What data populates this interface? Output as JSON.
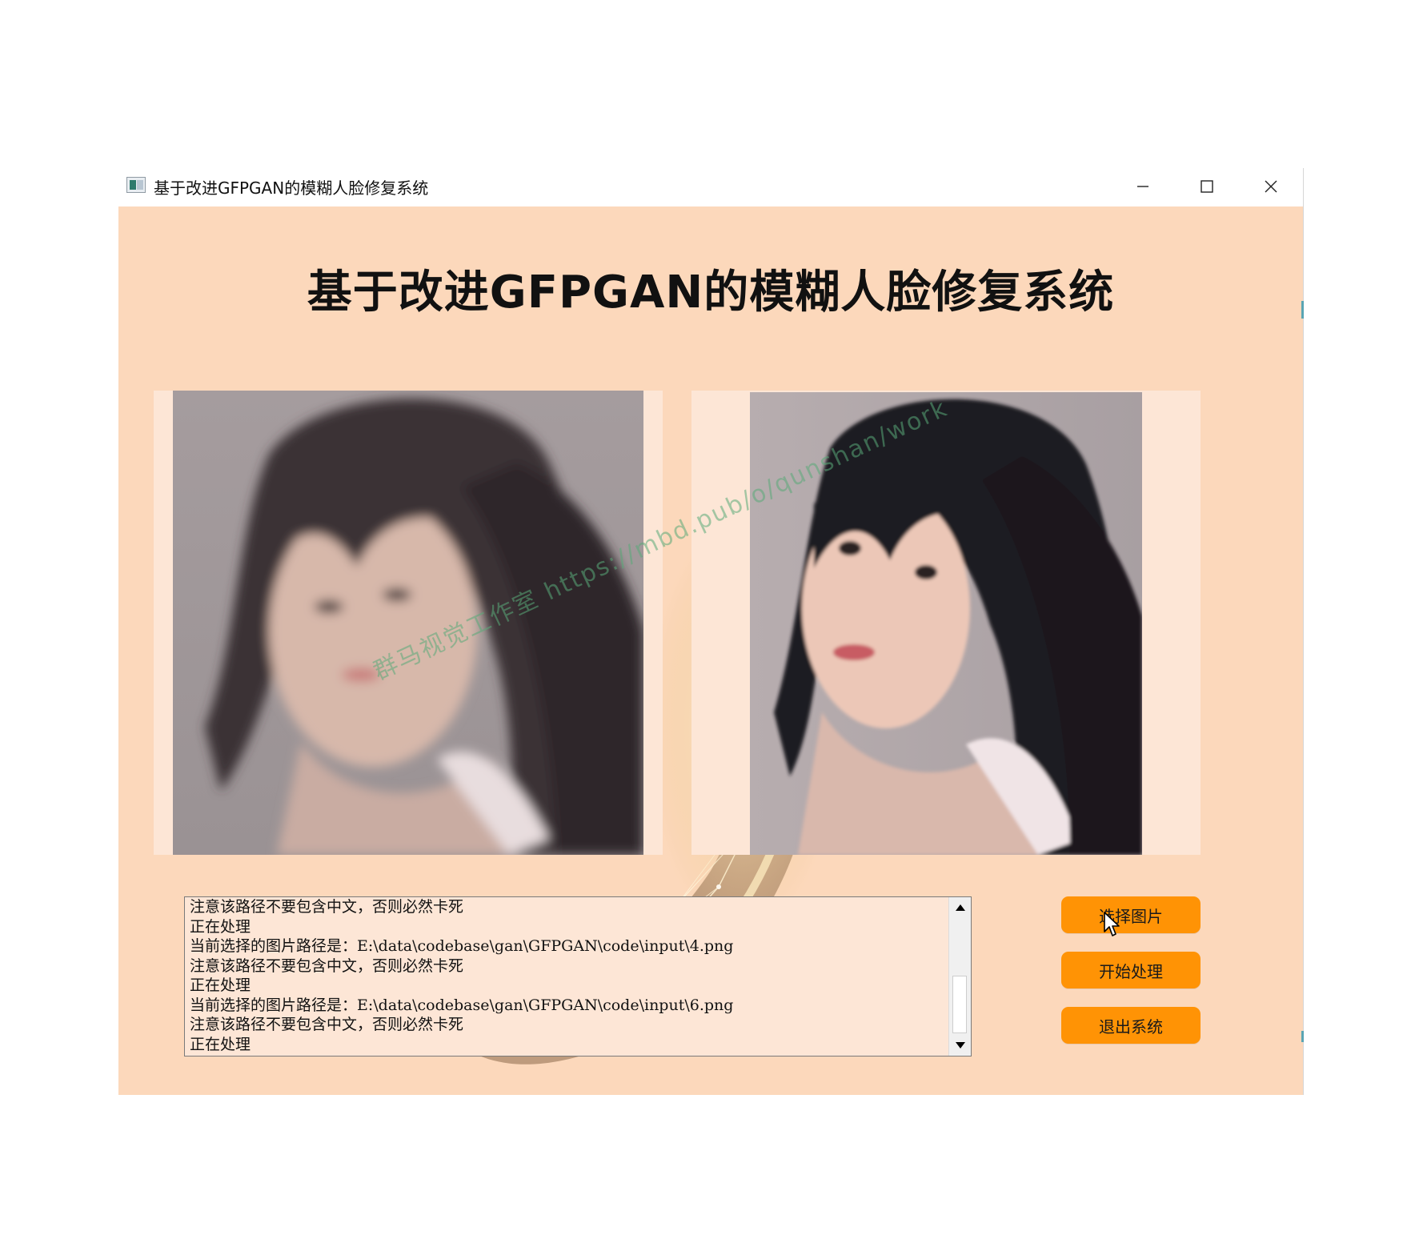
{
  "window": {
    "title": "基于改进GFPGAN的模糊人脸修复系统",
    "icon": "app-window-icon",
    "controls": [
      "minimize-icon",
      "maximize-icon",
      "close-icon"
    ]
  },
  "header": {
    "title": "基于改进GFPGAN的模糊人脸修复系统"
  },
  "images": {
    "original_label": "blurred input photo",
    "restored_label": "restored output photo"
  },
  "watermark": {
    "text": "群马视觉工作室 https://mbd.pub/o/qunshan/work"
  },
  "log": {
    "lines": [
      "注意该路径不要包含中文，否则必然卡死",
      "正在处理",
      "当前选择的图片路径是：E:\\data\\codebase\\gan\\GFPGAN\\code\\input\\4.png",
      "注意该路径不要包含中文，否则必然卡死",
      "正在处理",
      "当前选择的图片路径是：E:\\data\\codebase\\gan\\GFPGAN\\code\\input\\6.png",
      "注意该路径不要包含中文，否则必然卡死",
      "正在处理"
    ]
  },
  "buttons": {
    "select_label": "选择图片",
    "start_label": "开始处理",
    "exit_label": "退出系统"
  },
  "colors": {
    "background": "#fcd8bb",
    "panel": "#fde6d6",
    "button": "#ff9305"
  }
}
